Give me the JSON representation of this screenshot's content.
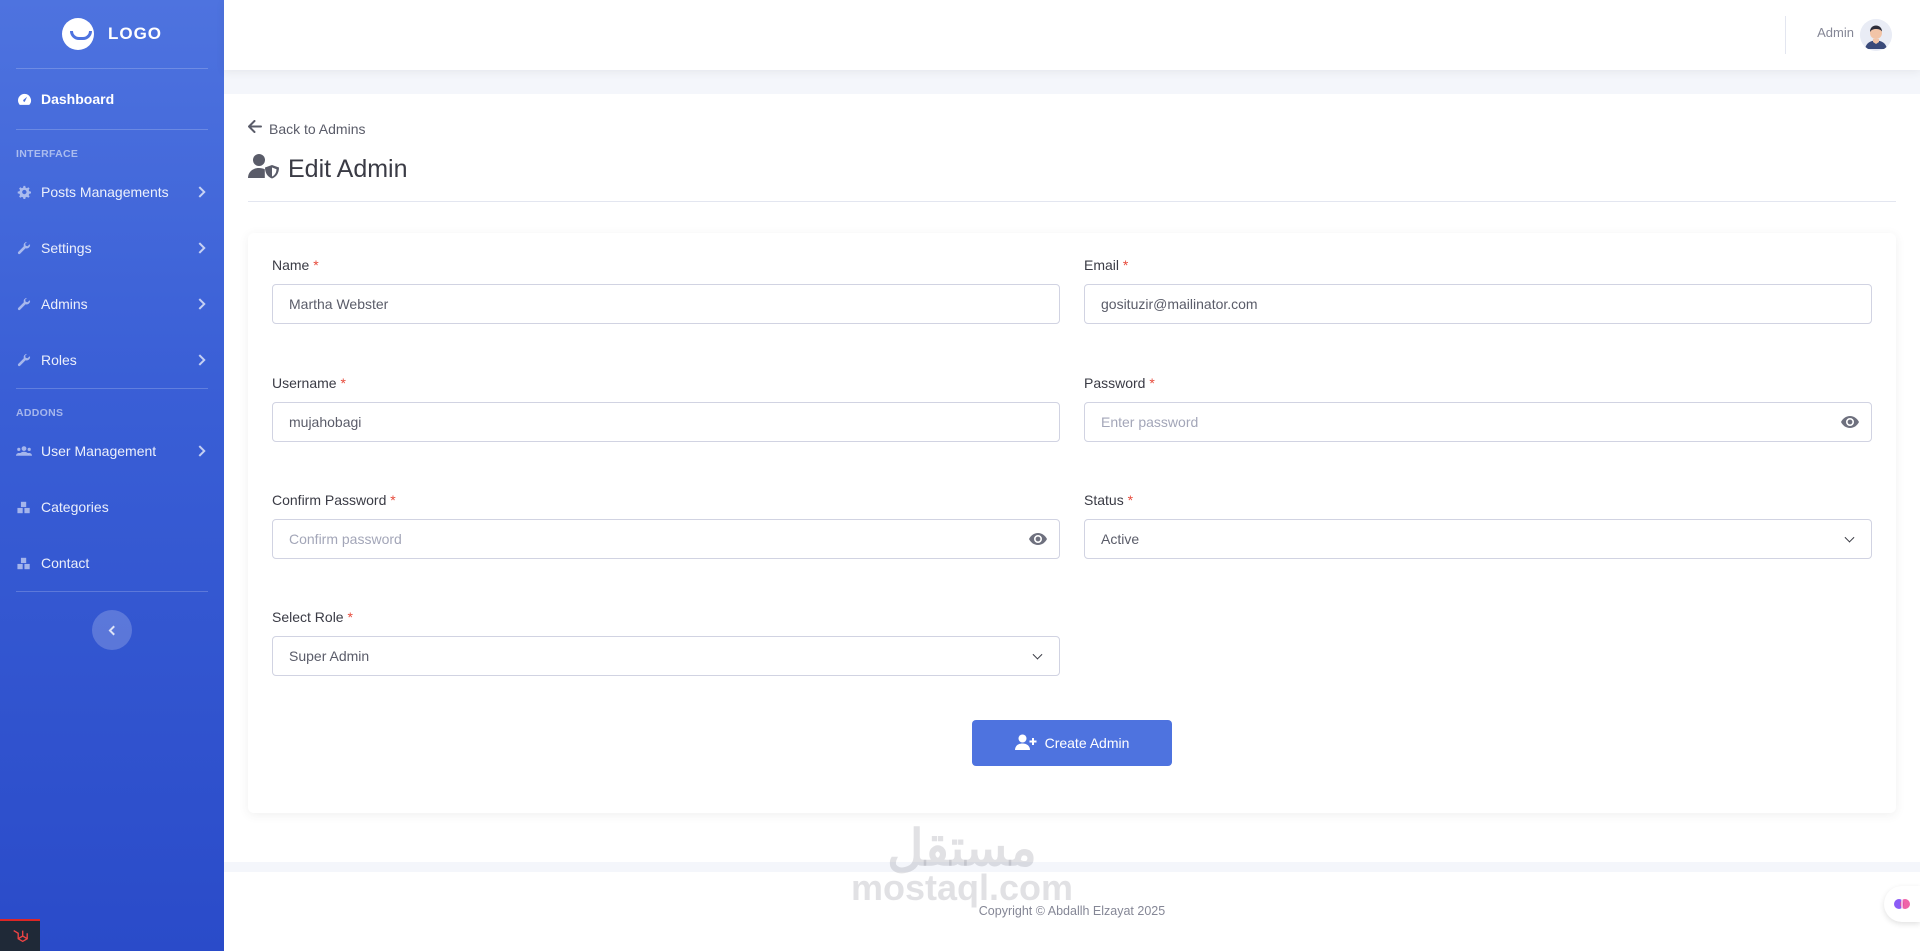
{
  "brand": {
    "logo_text": "LOGO"
  },
  "sidebar": {
    "dashboard": {
      "label": "Dashboard",
      "icon": "tachometer-icon"
    },
    "heading_interface": "INTERFACE",
    "heading_addons": "ADDONS",
    "items": [
      {
        "label": "Posts Managements",
        "icon": "cog-icon",
        "has_chevron": true
      },
      {
        "label": "Settings",
        "icon": "wrench-icon",
        "has_chevron": true
      },
      {
        "label": "Admins",
        "icon": "wrench-icon",
        "has_chevron": true
      },
      {
        "label": "Roles",
        "icon": "wrench-icon",
        "has_chevron": true
      },
      {
        "label": "User Management",
        "icon": "users-icon",
        "has_chevron": true
      },
      {
        "label": "Categories",
        "icon": "cubes-icon",
        "has_chevron": false
      },
      {
        "label": "Contact",
        "icon": "cubes-icon",
        "has_chevron": false
      }
    ]
  },
  "topbar": {
    "user_name": "Admin"
  },
  "page": {
    "back_link": "Back to Admins",
    "title": "Edit Admin"
  },
  "form": {
    "name": {
      "label": "Name",
      "value": "Martha Webster"
    },
    "email": {
      "label": "Email",
      "value": "gosituzir@mailinator.com"
    },
    "username": {
      "label": "Username",
      "value": "mujahobagi"
    },
    "password": {
      "label": "Password",
      "placeholder": "Enter password"
    },
    "confirm_password": {
      "label": "Confirm Password",
      "placeholder": "Confirm password"
    },
    "status": {
      "label": "Status",
      "selected": "Active"
    },
    "role": {
      "label": "Select Role",
      "selected": "Super Admin"
    },
    "required_mark": "*",
    "submit_label": "Create Admin"
  },
  "footer": {
    "copyright": "Copyright © Abdallh Elzayat 2025"
  },
  "watermark": {
    "arabic": "مستقل",
    "latin": "mostaql.com"
  },
  "colors": {
    "primary": "#4e73df",
    "danger": "#e74a3b",
    "text": "#5a5c69"
  }
}
